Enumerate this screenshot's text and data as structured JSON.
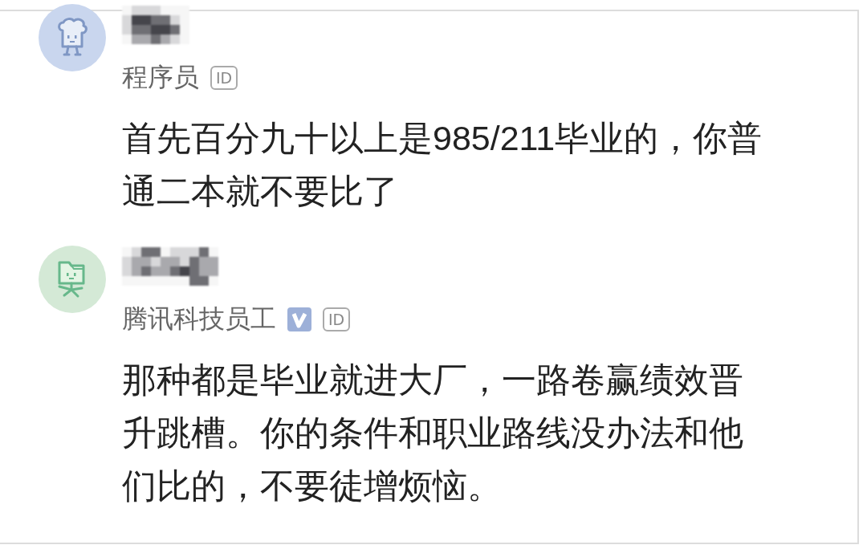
{
  "comments": [
    {
      "avatar": {
        "kind": "toast"
      },
      "title": "程序员",
      "verified": false,
      "id_badge": "ID",
      "body": "首先百分九十以上是985/211毕业的，你普通二本就不要比了"
    },
    {
      "avatar": {
        "kind": "folder"
      },
      "title": "腾讯科技员工",
      "verified": true,
      "id_badge": "ID",
      "body": "那种都是毕业就进大厂，一路卷赢绩效晋升跳槽。你的条件和职业路线没办法和他们比的，不要徒增烦恼。"
    }
  ]
}
